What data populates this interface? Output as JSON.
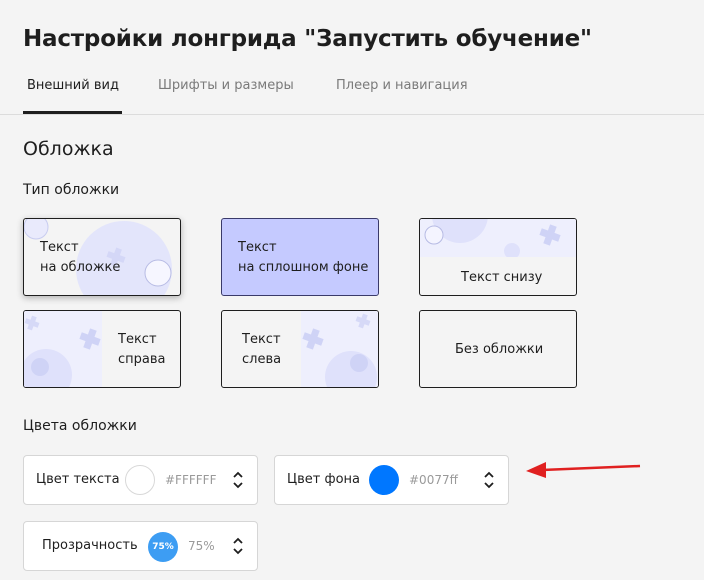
{
  "page": {
    "title": "Настройки лонгрида \"Запустить обучение\""
  },
  "tabs": [
    {
      "label": "Внешний вид",
      "active": true
    },
    {
      "label": "Шрифты и размеры",
      "active": false
    },
    {
      "label": "Плеер и навигация",
      "active": false
    }
  ],
  "cover_section": {
    "heading": "Обложка",
    "type_label": "Тип обложки",
    "options": [
      {
        "line1": "Текст",
        "line2": "на обложке",
        "selected": true
      },
      {
        "line1": "Текст",
        "line2": "на сплошном фоне"
      },
      {
        "line1": "Текст снизу"
      },
      {
        "line1": "Текст",
        "line2": "справа"
      },
      {
        "line1": "Текст",
        "line2": "слева"
      },
      {
        "line1": "Без обложки"
      }
    ]
  },
  "colors_section": {
    "label": "Цвета обложки",
    "text_color": {
      "label": "Цвет текста",
      "value": "#FFFFFF",
      "swatch": "#ffffff"
    },
    "bg_color": {
      "label": "Цвет фона",
      "value": "#0077ff",
      "swatch": "#0077ff"
    },
    "opacity": {
      "label": "Прозрачность",
      "badge": "75%",
      "value": "75%"
    }
  },
  "colors": {
    "accent": "#0077ff",
    "selected_bg": "#c5caff",
    "pattern": "#dadcff",
    "arrow": "#e02020"
  }
}
